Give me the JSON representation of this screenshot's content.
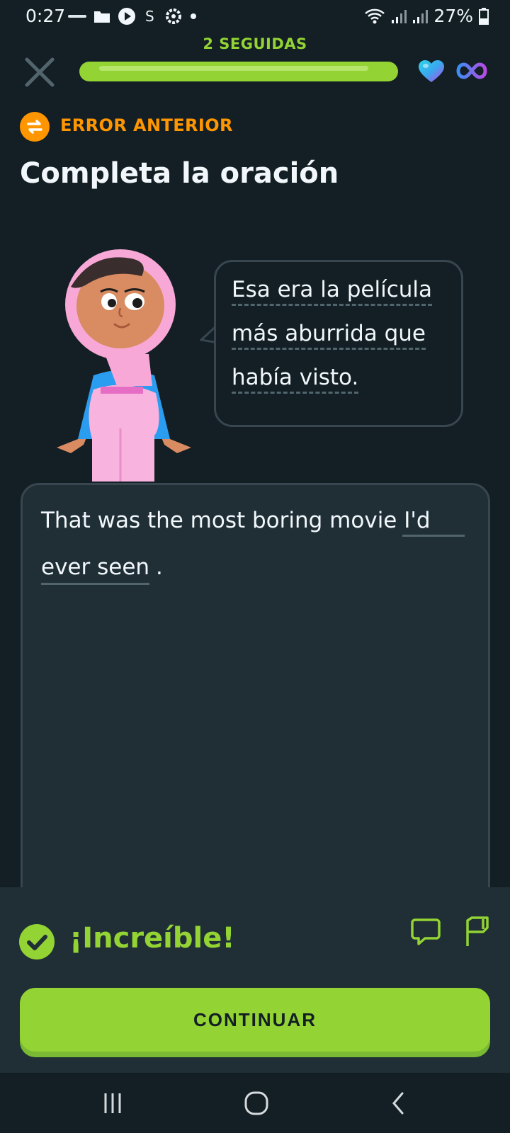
{
  "status_bar": {
    "time": "0:27",
    "battery": "27%",
    "left_icons": [
      "coursera-icon",
      "folder-icon",
      "play-icon",
      "s-icon",
      "settings-icon",
      "dot-icon"
    ],
    "right_icons": [
      "wifi-icon",
      "signal-icon",
      "signal-icon",
      "battery-icon"
    ]
  },
  "header": {
    "streak_label": "2 SEGUIDAS",
    "progress": 1.0,
    "hearts": "infinite"
  },
  "exercise": {
    "tag_label": "ERROR ANTERIOR",
    "title": "Completa la oración",
    "prompt_lines": [
      "Esa era la película",
      "más aburrida que",
      "había visto."
    ],
    "answer_line1": "That was the most boring movie I'd",
    "answer_line2": "ever seen",
    "answer_period": "."
  },
  "feedback": {
    "message": "¡Increíble!",
    "continue_label": "CONTINUAR"
  },
  "colors": {
    "background": "#131f24",
    "accent_green": "#93d333",
    "warning_orange": "#ff9600",
    "panel": "#202f36"
  }
}
